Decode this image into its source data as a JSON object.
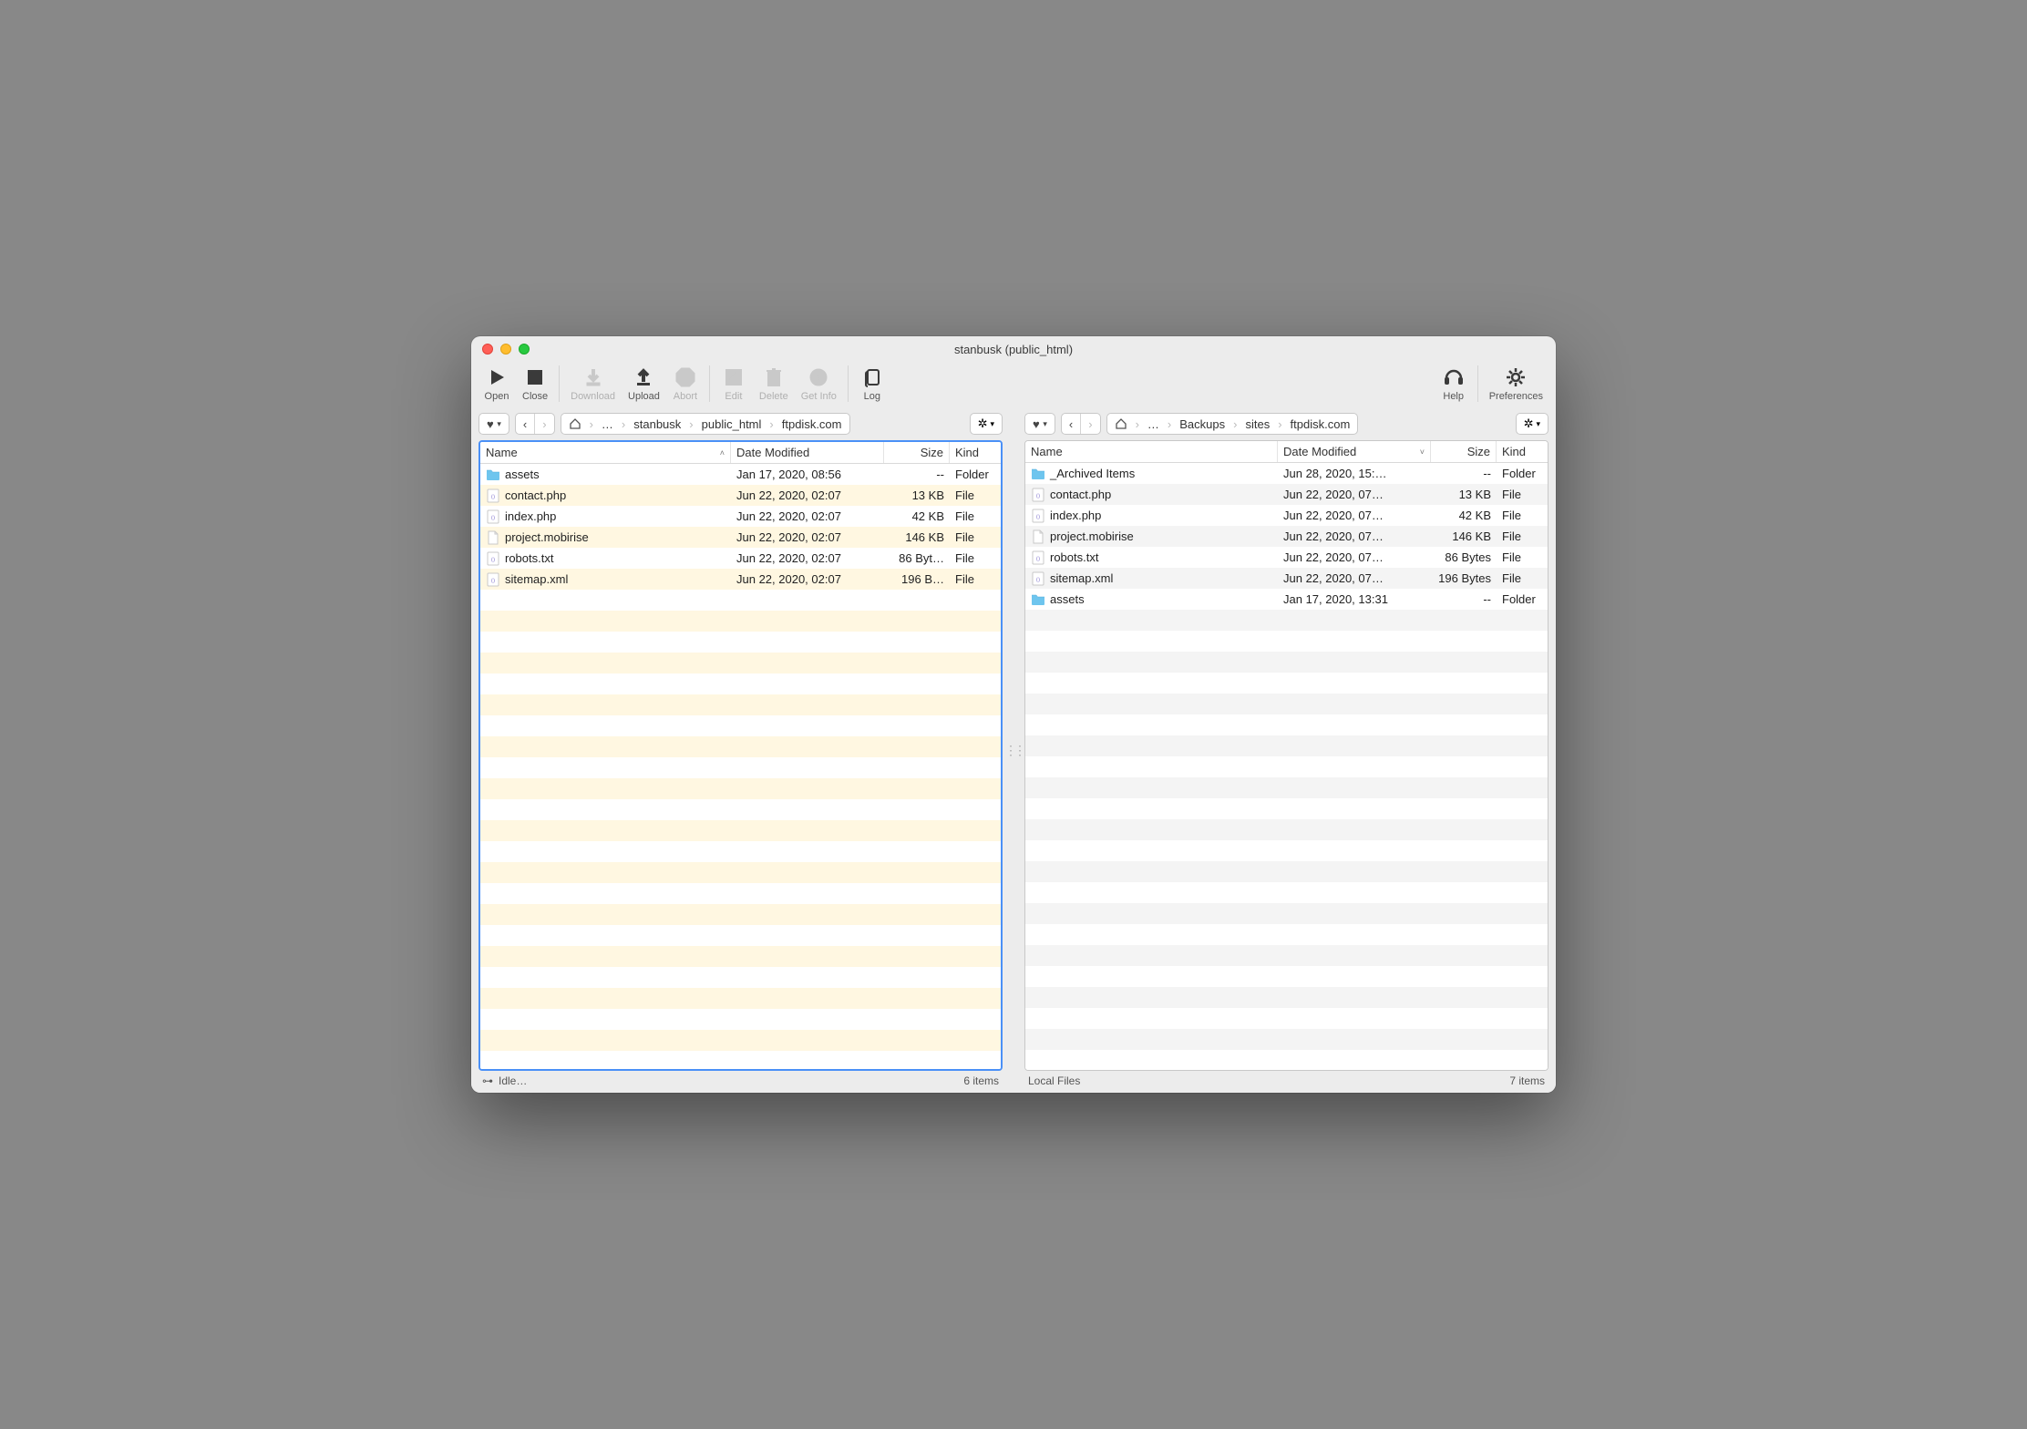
{
  "window": {
    "title": "stanbusk (public_html)"
  },
  "toolbar": {
    "open": "Open",
    "close": "Close",
    "download": "Download",
    "upload": "Upload",
    "abort": "Abort",
    "edit": "Edit",
    "delete": "Delete",
    "getinfo": "Get Info",
    "log": "Log",
    "help": "Help",
    "preferences": "Preferences"
  },
  "left": {
    "breadcrumbs": [
      "…",
      "stanbusk",
      "public_html",
      "ftpdisk.com"
    ],
    "columns": {
      "name": "Name",
      "date": "Date Modified",
      "size": "Size",
      "kind": "Kind"
    },
    "sort_asc": true,
    "rows": [
      {
        "icon": "folder",
        "name": "assets",
        "date": "Jan 17, 2020, 08:56",
        "size": "--",
        "kind": "Folder"
      },
      {
        "icon": "php",
        "name": "contact.php",
        "date": "Jun 22, 2020, 02:07",
        "size": "13 KB",
        "kind": "File"
      },
      {
        "icon": "php",
        "name": "index.php",
        "date": "Jun 22, 2020, 02:07",
        "size": "42 KB",
        "kind": "File"
      },
      {
        "icon": "file",
        "name": "project.mobirise",
        "date": "Jun 22, 2020, 02:07",
        "size": "146 KB",
        "kind": "File"
      },
      {
        "icon": "php",
        "name": "robots.txt",
        "date": "Jun 22, 2020, 02:07",
        "size": "86 Byt…",
        "kind": "File"
      },
      {
        "icon": "php",
        "name": "sitemap.xml",
        "date": "Jun 22, 2020, 02:07",
        "size": "196 B…",
        "kind": "File"
      }
    ],
    "status_text": "Idle…",
    "status_count": "6 items"
  },
  "right": {
    "breadcrumbs": [
      "…",
      "Backups",
      "sites",
      "ftpdisk.com"
    ],
    "columns": {
      "name": "Name",
      "date": "Date Modified",
      "size": "Size",
      "kind": "Kind"
    },
    "sort_desc": true,
    "rows": [
      {
        "icon": "folder",
        "name": "_Archived Items",
        "date": "Jun 28, 2020, 15:…",
        "size": "--",
        "kind": "Folder"
      },
      {
        "icon": "php",
        "name": "contact.php",
        "date": "Jun 22, 2020, 07…",
        "size": "13 KB",
        "kind": "File"
      },
      {
        "icon": "php",
        "name": "index.php",
        "date": "Jun 22, 2020, 07…",
        "size": "42 KB",
        "kind": "File"
      },
      {
        "icon": "file",
        "name": "project.mobirise",
        "date": "Jun 22, 2020, 07…",
        "size": "146 KB",
        "kind": "File"
      },
      {
        "icon": "php",
        "name": "robots.txt",
        "date": "Jun 22, 2020, 07…",
        "size": "86 Bytes",
        "kind": "File"
      },
      {
        "icon": "php",
        "name": "sitemap.xml",
        "date": "Jun 22, 2020, 07…",
        "size": "196 Bytes",
        "kind": "File"
      },
      {
        "icon": "folder",
        "name": "assets",
        "date": "Jan 17, 2020, 13:31",
        "size": "--",
        "kind": "Folder"
      }
    ],
    "status_text": "Local Files",
    "status_count": "7 items"
  }
}
